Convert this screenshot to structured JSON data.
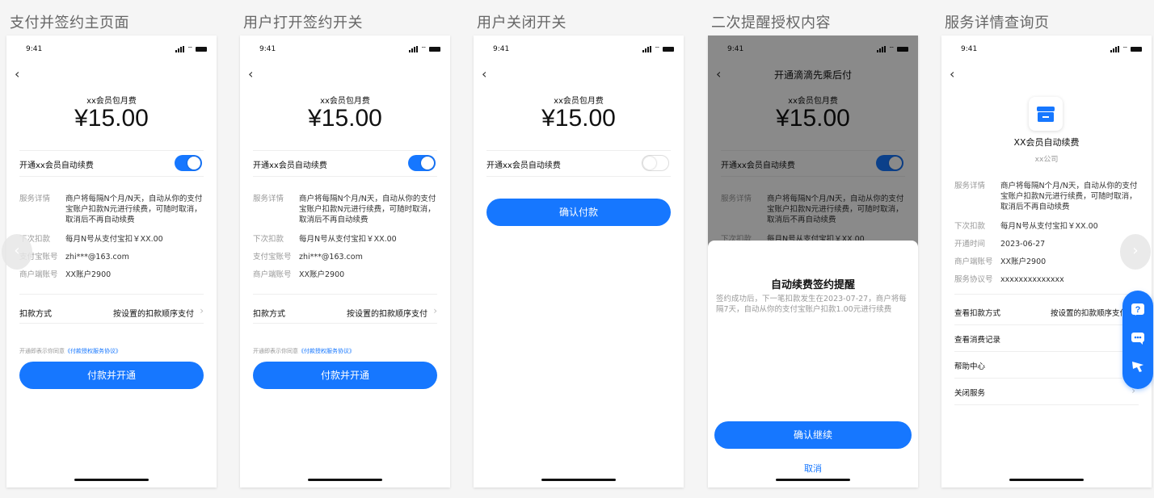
{
  "panels": [
    {
      "title": "支付并签约主页面"
    },
    {
      "title": "用户打开签约开关"
    },
    {
      "title": "用户关闭开关"
    },
    {
      "title": "二次提醒授权内容"
    },
    {
      "title": "服务详情查询页"
    }
  ],
  "status_bar": {
    "time": "9:41"
  },
  "common": {
    "subtitle": "xx会员包月费",
    "amount": "¥15.00",
    "toggle_label": "开通xx会员自动续费",
    "service_key": "服务详情",
    "service_value": "商户将每隔N个月/N天，自动从你的支付宝账户扣款N元进行续费，可随时取消，取消后不再自动续费",
    "next_key": "下次扣款",
    "next_value": "每月N号从支付宝扣￥XX.00",
    "alipay_key": "支付宝账号",
    "alipay_value": "zhi***@163.com",
    "merchant_key": "商户端账号",
    "merchant_value": "XX账户2900",
    "method_key": "扣款方式",
    "method_value": "按设置的扣款顺序支付",
    "agree_prefix": "开通即表示你同意",
    "agree_link": "《付款授权服务协议》",
    "pay_button": "付款并开通",
    "toggle_state": {
      "panel1": "on",
      "panel2": "on",
      "panel3": "off",
      "panel4": "on"
    }
  },
  "panel3": {
    "confirm_button": "确认付款"
  },
  "panel4": {
    "nav_title": "开通滴滴先乘后付",
    "sheet_title": "自动续费签约提醒",
    "sheet_body": "签约成功后，下一笔扣款发生在2023-07-27，商户将每隔7天，自动从你的支付宝账户扣款1.00元进行续费",
    "confirm_button": "确认继续",
    "cancel_button": "取消"
  },
  "panel5": {
    "merchant_name": "XX会员自动续费",
    "company": "xx公司",
    "service_key": "服务详情",
    "service_value": "商户将每隔N个月/N天，自动从你的支付宝账户扣款N元进行续费，可随时取消，取消后不再自动续费",
    "next_key": "下次扣款",
    "next_value": "每月N号从支付宝扣￥XX.00",
    "open_key": "开通时间",
    "open_value": "2023-06-27",
    "merchant_key": "商户端账号",
    "merchant_value": "XX账户2900",
    "agreement_key": "服务协议号",
    "agreement_value": "xxxxxxxxxxxxxx",
    "method_key": "查看扣款方式",
    "method_value": "按设置的扣款顺序支付",
    "records": "查看消费记录",
    "help": "帮助中心",
    "close": "关闭服务"
  },
  "colors": {
    "accent": "#1677ff"
  },
  "icons": [
    "back-icon",
    "signal-icon",
    "wifi-icon",
    "battery-icon",
    "chevron-right-icon",
    "store-icon",
    "question-icon",
    "chat-icon",
    "feedback-icon"
  ]
}
